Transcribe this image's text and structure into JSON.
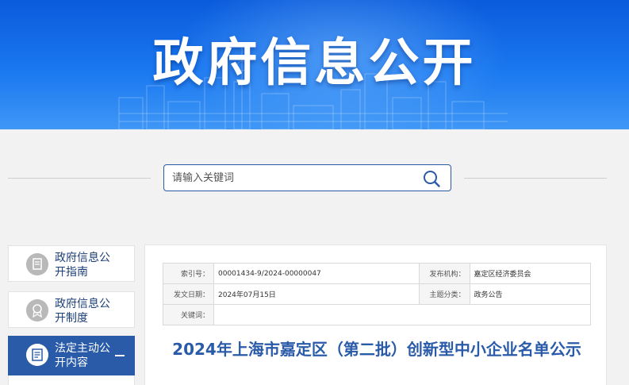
{
  "banner": {
    "title": "政府信息公开"
  },
  "search": {
    "placeholder": "请输入关键词"
  },
  "sidebar": {
    "items": [
      {
        "label": "政府信息公开指南"
      },
      {
        "label": "政府信息公开制度"
      },
      {
        "label": "法定主动公开内容",
        "expanded_marker": "−"
      }
    ]
  },
  "meta": {
    "index_label": "索引号：",
    "index_value": "00001434-9/2024-00000047",
    "publisher_label": "发布机构：",
    "publisher_value": "嘉定区经济委员会",
    "date_label": "发文日期：",
    "date_value": "2024年07月15日",
    "category_label": "主题分类：",
    "category_value": "政务公告",
    "keywords_label": "关键词：",
    "keywords_value": ""
  },
  "document": {
    "title": "2024年上海市嘉定区（第二批）创新型中小企业名单公示"
  },
  "colors": {
    "banner": "#1a78f0",
    "accent": "#2a5ba8"
  }
}
